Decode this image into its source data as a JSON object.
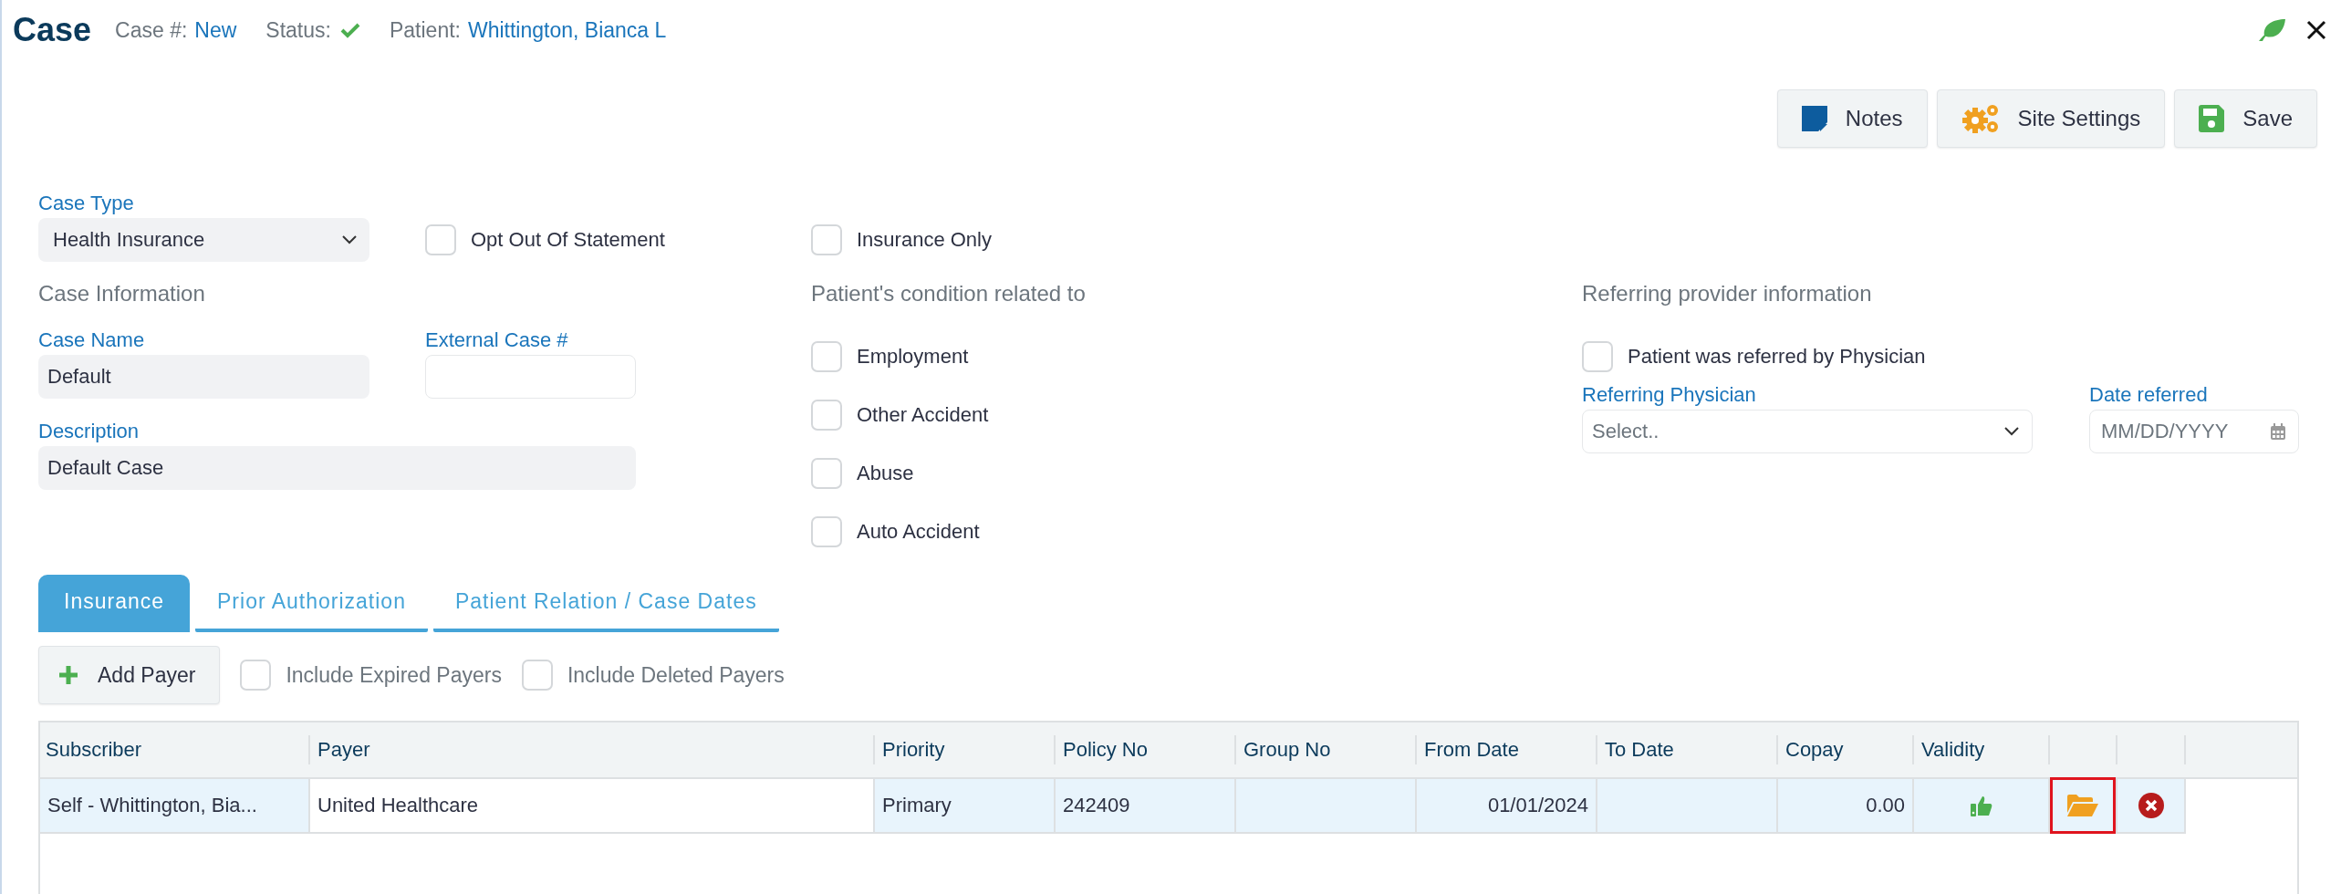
{
  "header": {
    "title": "Case",
    "case_label": "Case #:",
    "case_value": "New",
    "status_label": "Status:",
    "status_ok": true,
    "patient_label": "Patient:",
    "patient_value": "Whittington, Bianca L"
  },
  "toolbar": [
    {
      "kind": "notes",
      "label": "Notes"
    },
    {
      "kind": "settings",
      "label": "Site Settings"
    },
    {
      "kind": "save",
      "label": "Save"
    }
  ],
  "case_type": {
    "label": "Case Type",
    "value": "Health Insurance"
  },
  "top_options": [
    {
      "label": "Opt Out Of Statement",
      "checked": false
    },
    {
      "label": "Insurance Only",
      "checked": false
    }
  ],
  "case_information": {
    "heading": "Case Information",
    "case_name": {
      "label": "Case Name",
      "value": "Default"
    },
    "external_case": {
      "label": "External Case #"
    },
    "description": {
      "label": "Description",
      "value": "Default Case"
    }
  },
  "condition": {
    "heading": "Patient's condition related to",
    "items": [
      {
        "label": "Employment",
        "checked": false
      },
      {
        "label": "Other Accident",
        "checked": false
      },
      {
        "label": "Abuse",
        "checked": false
      },
      {
        "label": "Auto Accident",
        "checked": false
      }
    ]
  },
  "referring": {
    "heading": "Referring provider information",
    "referred_by_physician": {
      "label": "Patient was referred by Physician",
      "checked": false
    },
    "physician": {
      "label": "Referring Physician",
      "placeholder": "Select.."
    },
    "date": {
      "label": "Date referred",
      "placeholder": "MM/DD/YYYY"
    }
  },
  "tabs": [
    {
      "label": "Insurance",
      "selected": true
    },
    {
      "label": "Prior Authorization",
      "selected": false
    },
    {
      "label": "Patient Relation / Case Dates",
      "selected": false
    }
  ],
  "payer_toolbar": {
    "add_label": "Add Payer",
    "filters": [
      {
        "label": "Include Expired Payers",
        "checked": false
      },
      {
        "label": "Include Deleted Payers",
        "checked": false
      }
    ]
  },
  "table": {
    "columns": [
      "Subscriber",
      "Payer",
      "Priority",
      "Policy No",
      "Group No",
      "From Date",
      "To Date",
      "Copay",
      "Validity"
    ],
    "rows": [
      {
        "subscriber": "Self - Whittington, Bia...",
        "payer": "United Healthcare",
        "priority": "Primary",
        "policy_no": "242409",
        "from_date": "01/01/2024",
        "copay": "0.00",
        "valid": true,
        "open_highlighted": true
      }
    ]
  }
}
